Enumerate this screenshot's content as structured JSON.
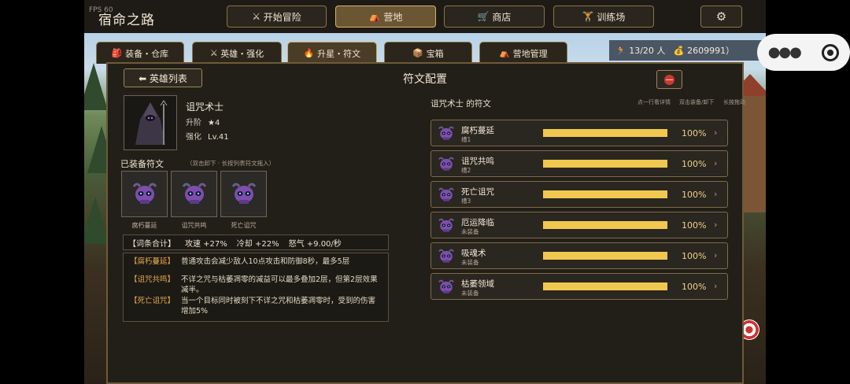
{
  "app": {
    "fps": "FPS 60",
    "title": "宿命之路"
  },
  "topnav": [
    {
      "icon": "⚔",
      "label": "开始冒险",
      "active": false
    },
    {
      "icon": "⛺",
      "label": "营地",
      "active": true
    },
    {
      "icon": "🛒",
      "label": "商店",
      "active": false
    },
    {
      "icon": "🏋",
      "label": "训练场",
      "active": false
    }
  ],
  "settings_icon": "gear-icon",
  "tabs": [
    {
      "icon": "🎒",
      "label": "装备・仓库"
    },
    {
      "icon": "⚔",
      "label": "英雄・强化"
    },
    {
      "icon": "🔥",
      "label": "升星・符文"
    },
    {
      "icon": "📦",
      "label": "宝箱"
    },
    {
      "icon": "⛺",
      "label": "营地管理"
    }
  ],
  "stats": {
    "heroes": "13/20 人",
    "gold": "2609991）"
  },
  "panel": {
    "back_label": "⬅ 英雄列表",
    "title": "符文配置",
    "close_icon": "⛔"
  },
  "hero": {
    "name": "诅咒术士",
    "star_label": "升阶",
    "star_value": "★4",
    "level_label": "强化",
    "level_value": "Lv.41"
  },
  "equipped": {
    "title": "已装备符文",
    "hint": "（双击卸下 · 长按列表符文拖入）",
    "slots": [
      "腐朽蔓延",
      "诅咒共鸣",
      "死亡诅咒"
    ]
  },
  "summary": {
    "label": "【词条合计】",
    "items": [
      "攻速 +27%",
      "冷却 +22%",
      "怒气 +9.00/秒"
    ]
  },
  "effects": [
    {
      "key": "【腐朽蔓延】",
      "text": "普通攻击会减少敌人10点攻击和防御8秒，最多5层"
    },
    {
      "key": "【诅咒共鸣】",
      "text": "不详之咒与枯萎凋零的减益可以最多叠加2层，但第2层效果减半。"
    },
    {
      "key": "【死亡诅咒】",
      "text": "当一个目标同时被刻下不详之咒和枯萎凋零时，受到的伤害增加5%"
    }
  ],
  "runes": {
    "heading": "诅咒术士 的符文",
    "hints": [
      "点一行看详情",
      "双击装备/卸下",
      "长按拖动"
    ],
    "list": [
      {
        "name": "腐朽蔓延",
        "status": "槽1",
        "progress": 1.0,
        "percent": "100%"
      },
      {
        "name": "诅咒共鸣",
        "status": "槽2",
        "progress": 1.0,
        "percent": "100%"
      },
      {
        "name": "死亡诅咒",
        "status": "槽3",
        "progress": 1.0,
        "percent": "100%"
      },
      {
        "name": "厄运降临",
        "status": "未装备",
        "progress": 1.0,
        "percent": "100%"
      },
      {
        "name": "吸魂术",
        "status": "未装备",
        "progress": 1.0,
        "percent": "100%"
      },
      {
        "name": "枯萎领域",
        "status": "未装备",
        "progress": 1.0,
        "percent": "100%"
      }
    ]
  },
  "colors": {
    "accent": "#f0c850",
    "frame": "#8a7447",
    "panel": "#221f19"
  }
}
